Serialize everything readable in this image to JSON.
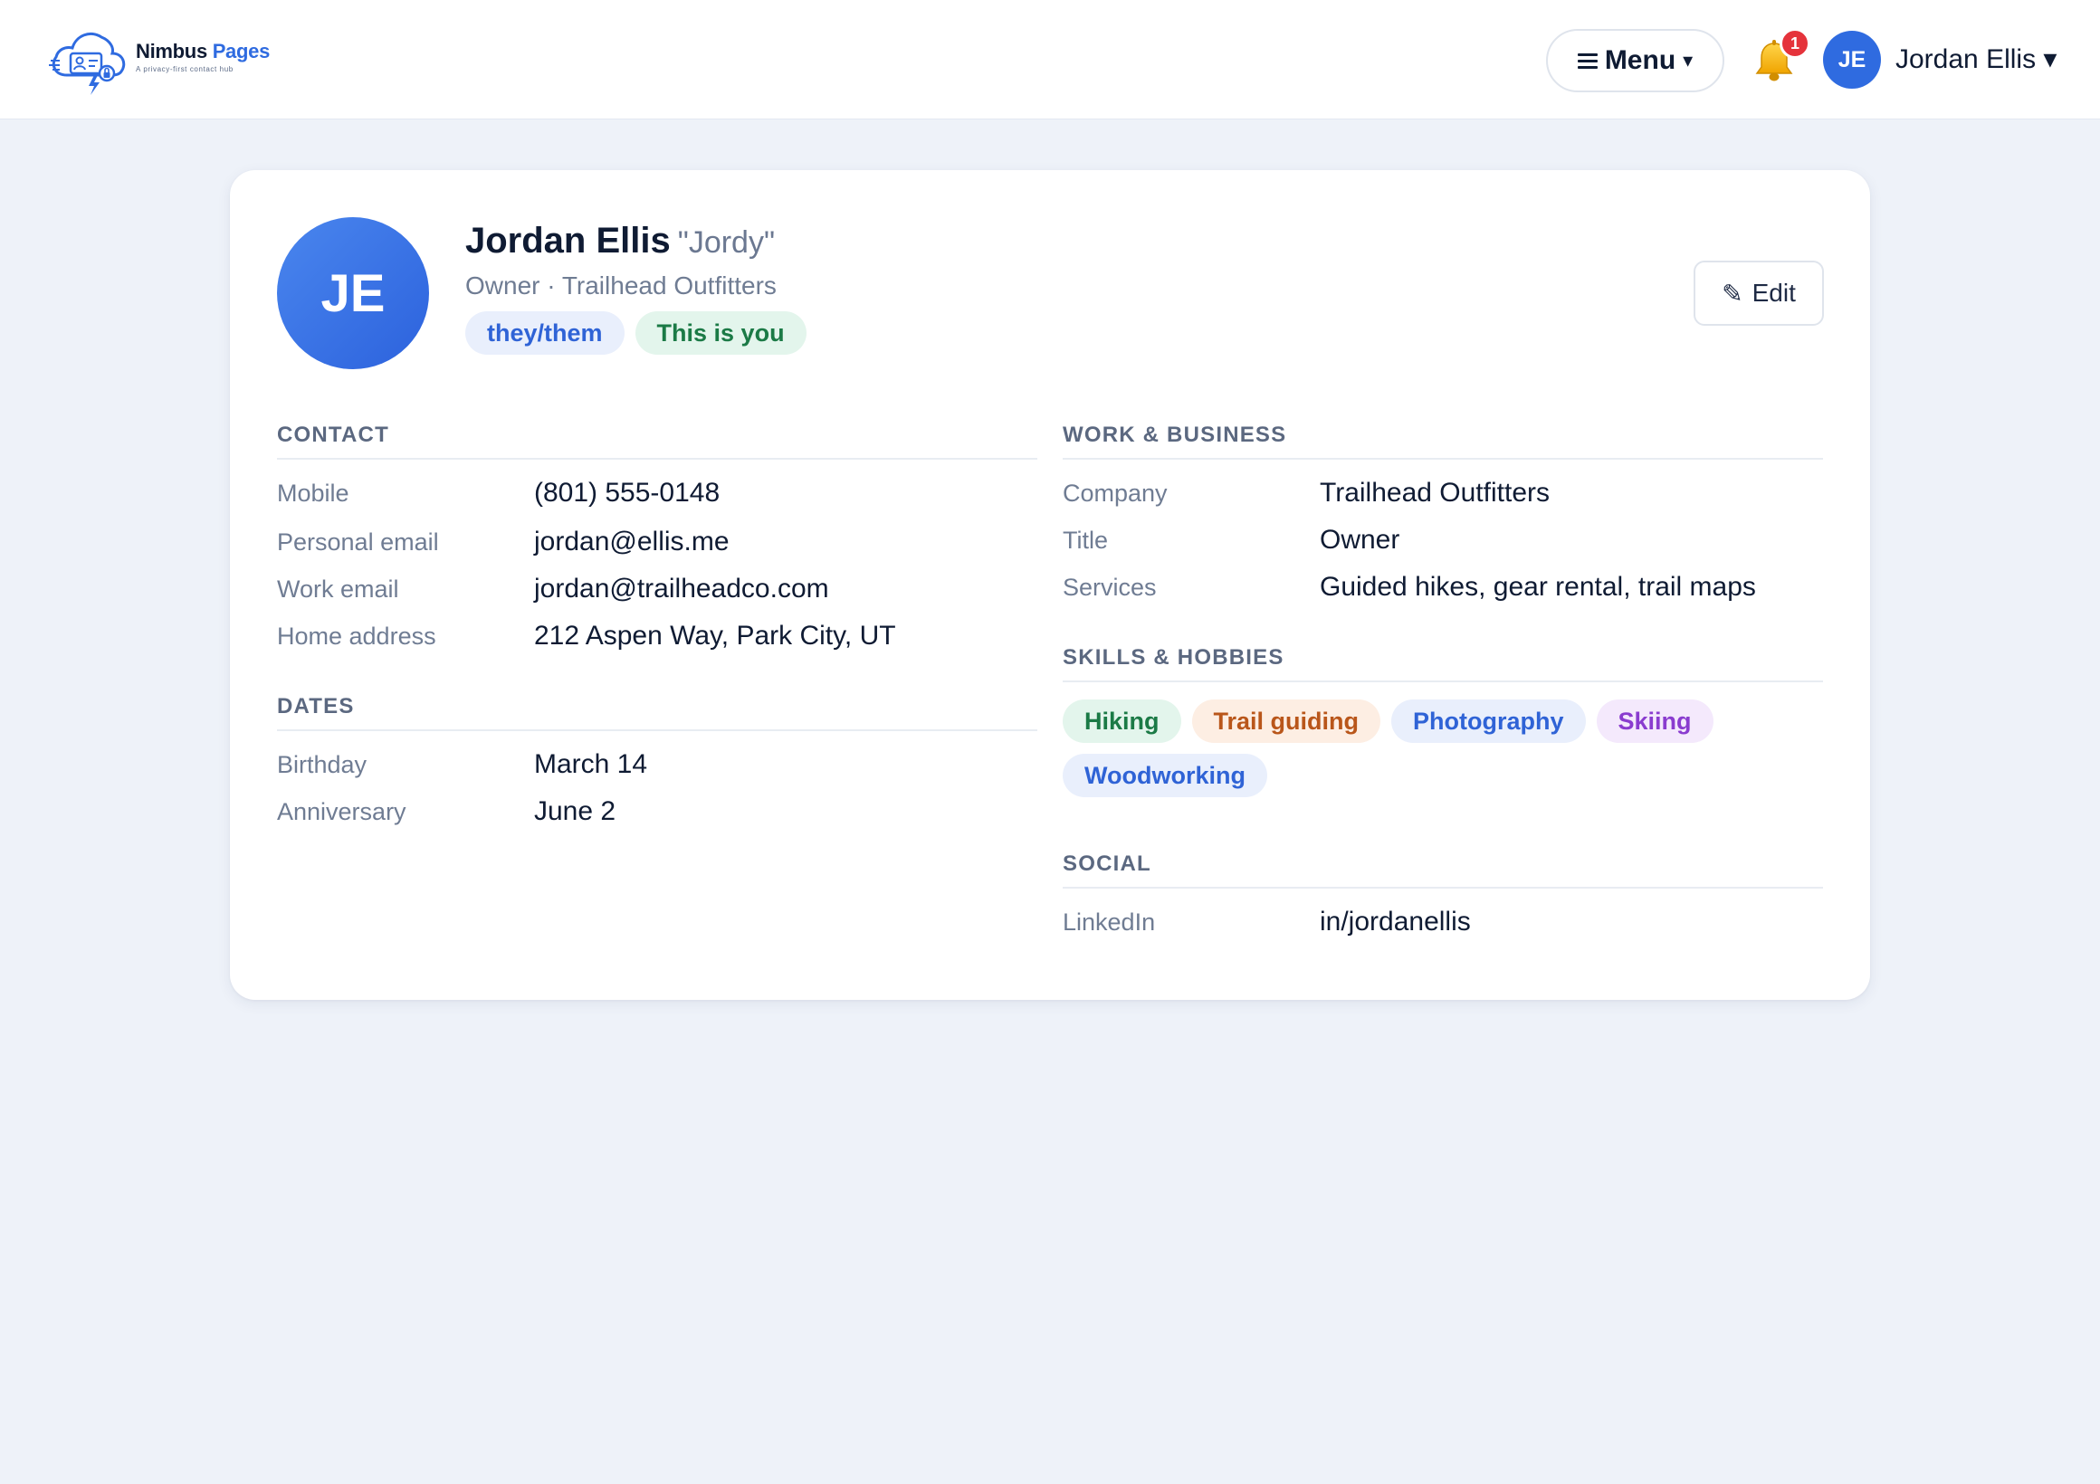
{
  "header": {
    "logo": {
      "name_part1": "Nimbus",
      "name_part2": "Pages",
      "tagline": "A privacy-first contact hub"
    },
    "menu_label": "Menu",
    "menu_caret": "▾",
    "notification_count": "1",
    "user": {
      "initials": "JE",
      "name": "Jordan Ellis ▾"
    }
  },
  "profile": {
    "initials": "JE",
    "full_name": "Jordan Ellis",
    "nickname": "\"Jordy\"",
    "role": "Owner · Trailhead Outfitters",
    "pills": [
      {
        "label": "they/them"
      },
      {
        "label": "This is you"
      }
    ],
    "edit_icon": "✎",
    "edit_label": "Edit"
  },
  "contact": {
    "title": "CONTACT",
    "rows": [
      {
        "label": "Mobile",
        "value": "(801) 555-0148"
      },
      {
        "label": "Personal email",
        "value": "jordan@ellis.me"
      },
      {
        "label": "Work email",
        "value": "jordan@trailheadco.com"
      },
      {
        "label": "Home address",
        "value": "212 Aspen Way, Park City, UT"
      }
    ]
  },
  "dates": {
    "title": "DATES",
    "rows": [
      {
        "label": "Birthday",
        "value": "March 14"
      },
      {
        "label": "Anniversary",
        "value": "June 2"
      }
    ]
  },
  "work": {
    "title": "WORK & BUSINESS",
    "rows": [
      {
        "label": "Company",
        "value": "Trailhead Outfitters"
      },
      {
        "label": "Title",
        "value": "Owner"
      },
      {
        "label": "Services",
        "value": "Guided hikes, gear rental, trail maps"
      }
    ]
  },
  "skills": {
    "title": "SKILLS & HOBBIES",
    "tags": [
      {
        "label": "Hiking",
        "bg": "#e3f5ec",
        "fg": "#1b7a46"
      },
      {
        "label": "Trail guiding",
        "bg": "#fdeee3",
        "fg": "#b9561a"
      },
      {
        "label": "Photography",
        "bg": "#e9effc",
        "fg": "#2f63d6"
      },
      {
        "label": "Skiing",
        "bg": "#f4e9fc",
        "fg": "#8a3ccf"
      },
      {
        "label": "Woodworking",
        "bg": "#e9effc",
        "fg": "#2f63d6"
      }
    ]
  },
  "social": {
    "title": "SOCIAL",
    "rows": [
      {
        "label": "LinkedIn",
        "value": "in/jordanellis"
      }
    ]
  },
  "colors": {
    "brand": "#2f6be0",
    "page_bg": "#eef2f9",
    "badge": "#e5333b"
  }
}
